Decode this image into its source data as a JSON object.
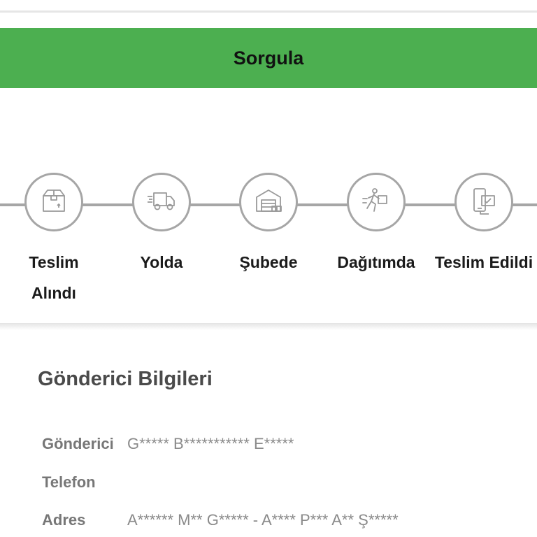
{
  "query_button": {
    "label": "Sorgula"
  },
  "tracker": {
    "steps": [
      {
        "label": "Teslim Alındı",
        "icon": "package-icon"
      },
      {
        "label": "Yolda",
        "icon": "delivery-truck-icon"
      },
      {
        "label": "Şubede",
        "icon": "warehouse-icon"
      },
      {
        "label": "Dağıtımda",
        "icon": "courier-running-icon"
      },
      {
        "label": "Teslim Edildi",
        "icon": "phone-delivered-icon"
      }
    ]
  },
  "sender_info": {
    "title": "Gönderici Bilgileri",
    "rows": [
      {
        "label": "Gönderici",
        "value": "G***** B*********** E*****"
      },
      {
        "label": "Telefon",
        "value": ""
      },
      {
        "label": "Adres",
        "value": "A****** M** G***** - A**** P*** A** Ş*****"
      }
    ]
  },
  "colors": {
    "accent_green": "#4caf50",
    "step_gray": "#a6a6a6",
    "title_text": "#4a4a4a"
  }
}
